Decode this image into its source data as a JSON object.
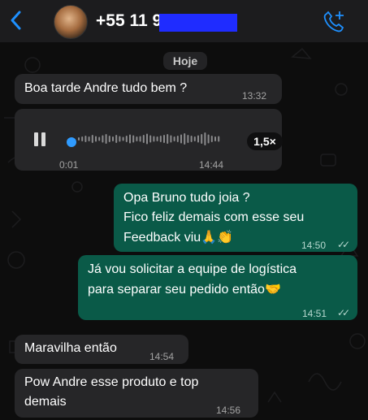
{
  "header": {
    "back_icon": "chevron-left-icon",
    "phone_visible": "+55 11 9",
    "call_icon": "phone-plus-icon"
  },
  "date_chip": "Hoje",
  "messages": [
    {
      "direction": "in",
      "type": "text",
      "text": "Boa tarde Andre tudo bem ?",
      "time": "13:32"
    },
    {
      "direction": "in",
      "type": "voice",
      "elapsed": "0:01",
      "duration": "14:44",
      "speed": "1,5×"
    },
    {
      "direction": "out",
      "type": "text",
      "lines": [
        "Opa Bruno tudo joia ?",
        "Fico feliz demais com esse seu",
        "Feedback viu"
      ],
      "emoji": "🙏👏",
      "time": "14:50",
      "status": "read"
    },
    {
      "direction": "out",
      "type": "text",
      "lines": [
        "Já vou solicitar a equipe de logística",
        "para separar seu pedido então"
      ],
      "emoji": "🤝",
      "time": "14:51",
      "status": "read"
    },
    {
      "direction": "in",
      "type": "text",
      "text": "Maravilha então",
      "time": "14:54"
    },
    {
      "direction": "in",
      "type": "text",
      "lines": [
        "Pow Andre esse produto e top",
        "demais"
      ],
      "time": "14:56"
    }
  ],
  "colors": {
    "incoming": "#262628",
    "outgoing": "#0a5a48",
    "accent": "#1e90ff"
  }
}
